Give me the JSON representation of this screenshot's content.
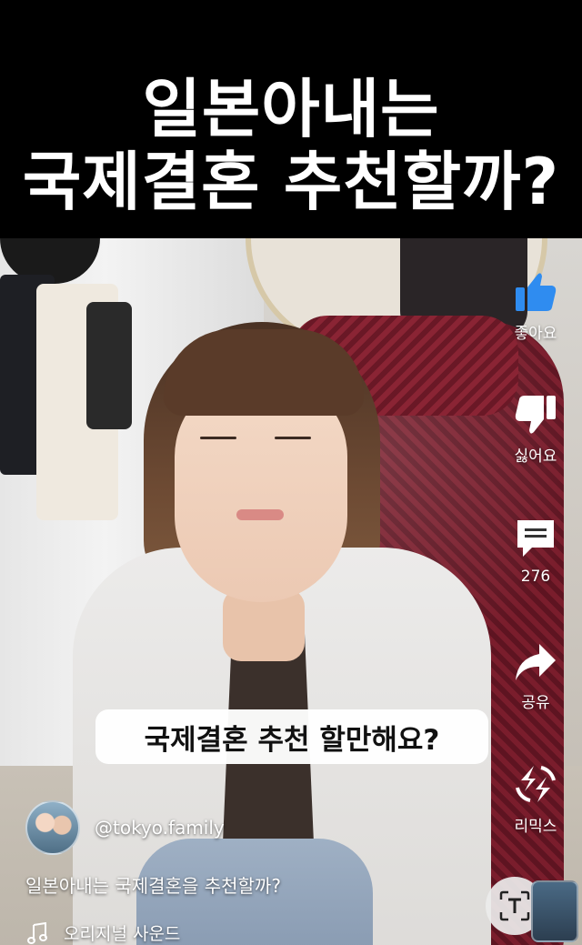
{
  "title": {
    "line1": "일본아내는",
    "line2": "국제결혼 추천할까?"
  },
  "video": {
    "caption": "국제결혼 추천 할만해요?"
  },
  "actions": {
    "like_label": "좋아요",
    "dislike_label": "싫어요",
    "comment_count": "276",
    "share_label": "공유",
    "remix_label": "리믹스"
  },
  "channel": {
    "handle": "@tokyo.family"
  },
  "description": "일본아내는 국제결혼을 추천할까?",
  "sound": {
    "label": "오리지널 사운드",
    "icon": "music-note-icon"
  },
  "icons": {
    "like": "thumbs-up-icon",
    "dislike": "thumbs-down-icon",
    "comment": "comment-icon",
    "share": "share-arrow-icon",
    "remix": "remix-icon",
    "lens": "lens-text-icon"
  },
  "colors": {
    "like_accent": "#2f8cf0"
  }
}
